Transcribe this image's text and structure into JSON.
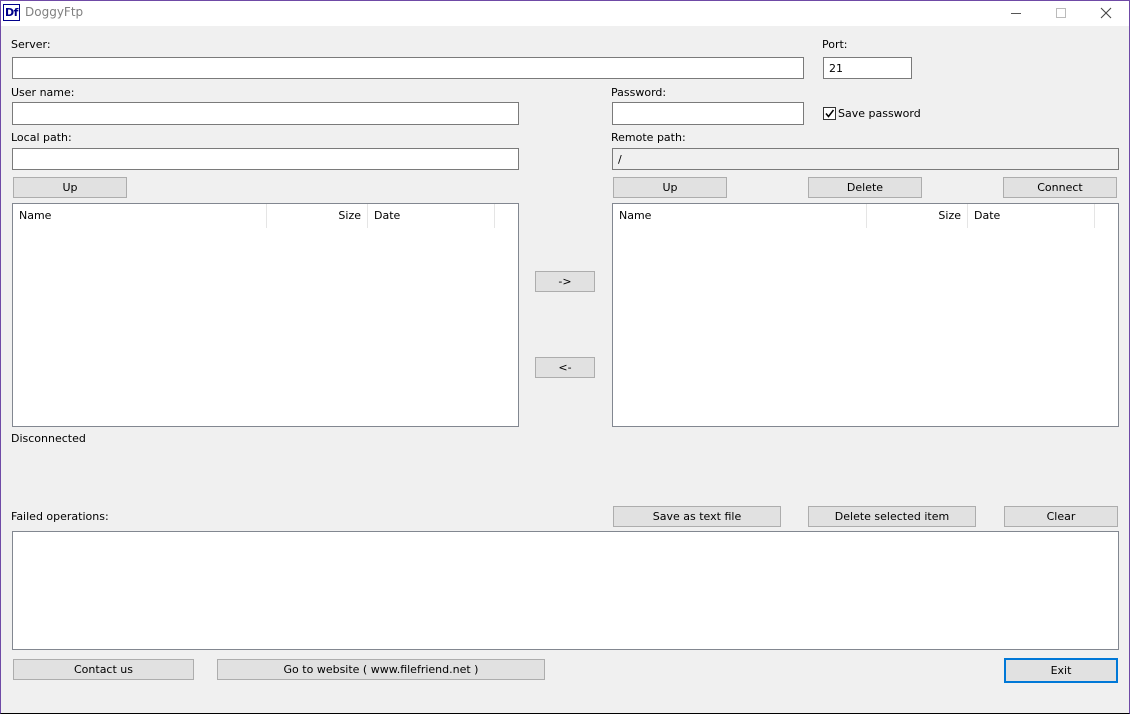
{
  "window": {
    "app_icon_text": "Df",
    "title": "DoggyFtp",
    "controls": {
      "minimize": "minimize-icon",
      "maximize": "maximize-icon",
      "close": "close-icon"
    }
  },
  "connection": {
    "server_label": "Server:",
    "server_value": "",
    "port_label": "Port:",
    "port_value": "21",
    "username_label": "User name:",
    "username_value": "",
    "password_label": "Password:",
    "password_value": "",
    "save_password_label": "Save password",
    "save_password_checked": true
  },
  "local": {
    "path_label": "Local path:",
    "path_value": "",
    "up_label": "Up",
    "columns": [
      "Name",
      "Size",
      "Date"
    ],
    "rows": []
  },
  "remote": {
    "path_label": "Remote path:",
    "path_value": "/",
    "up_label": "Up",
    "delete_label": "Delete",
    "connect_label": "Connect",
    "columns": [
      "Name",
      "Size",
      "Date"
    ],
    "rows": []
  },
  "transfer": {
    "upload_label": "->",
    "download_label": "<-"
  },
  "status": {
    "text": "Disconnected"
  },
  "failed": {
    "label": "Failed operations:",
    "save_label": "Save as text file",
    "delete_selected_label": "Delete selected item",
    "clear_label": "Clear",
    "items": []
  },
  "footer": {
    "contact_label": "Contact us",
    "website_label": "Go to website ( www.filefriend.net )",
    "exit_label": "Exit"
  },
  "colors": {
    "accent": "#0078d7",
    "icon": "#00008b"
  }
}
